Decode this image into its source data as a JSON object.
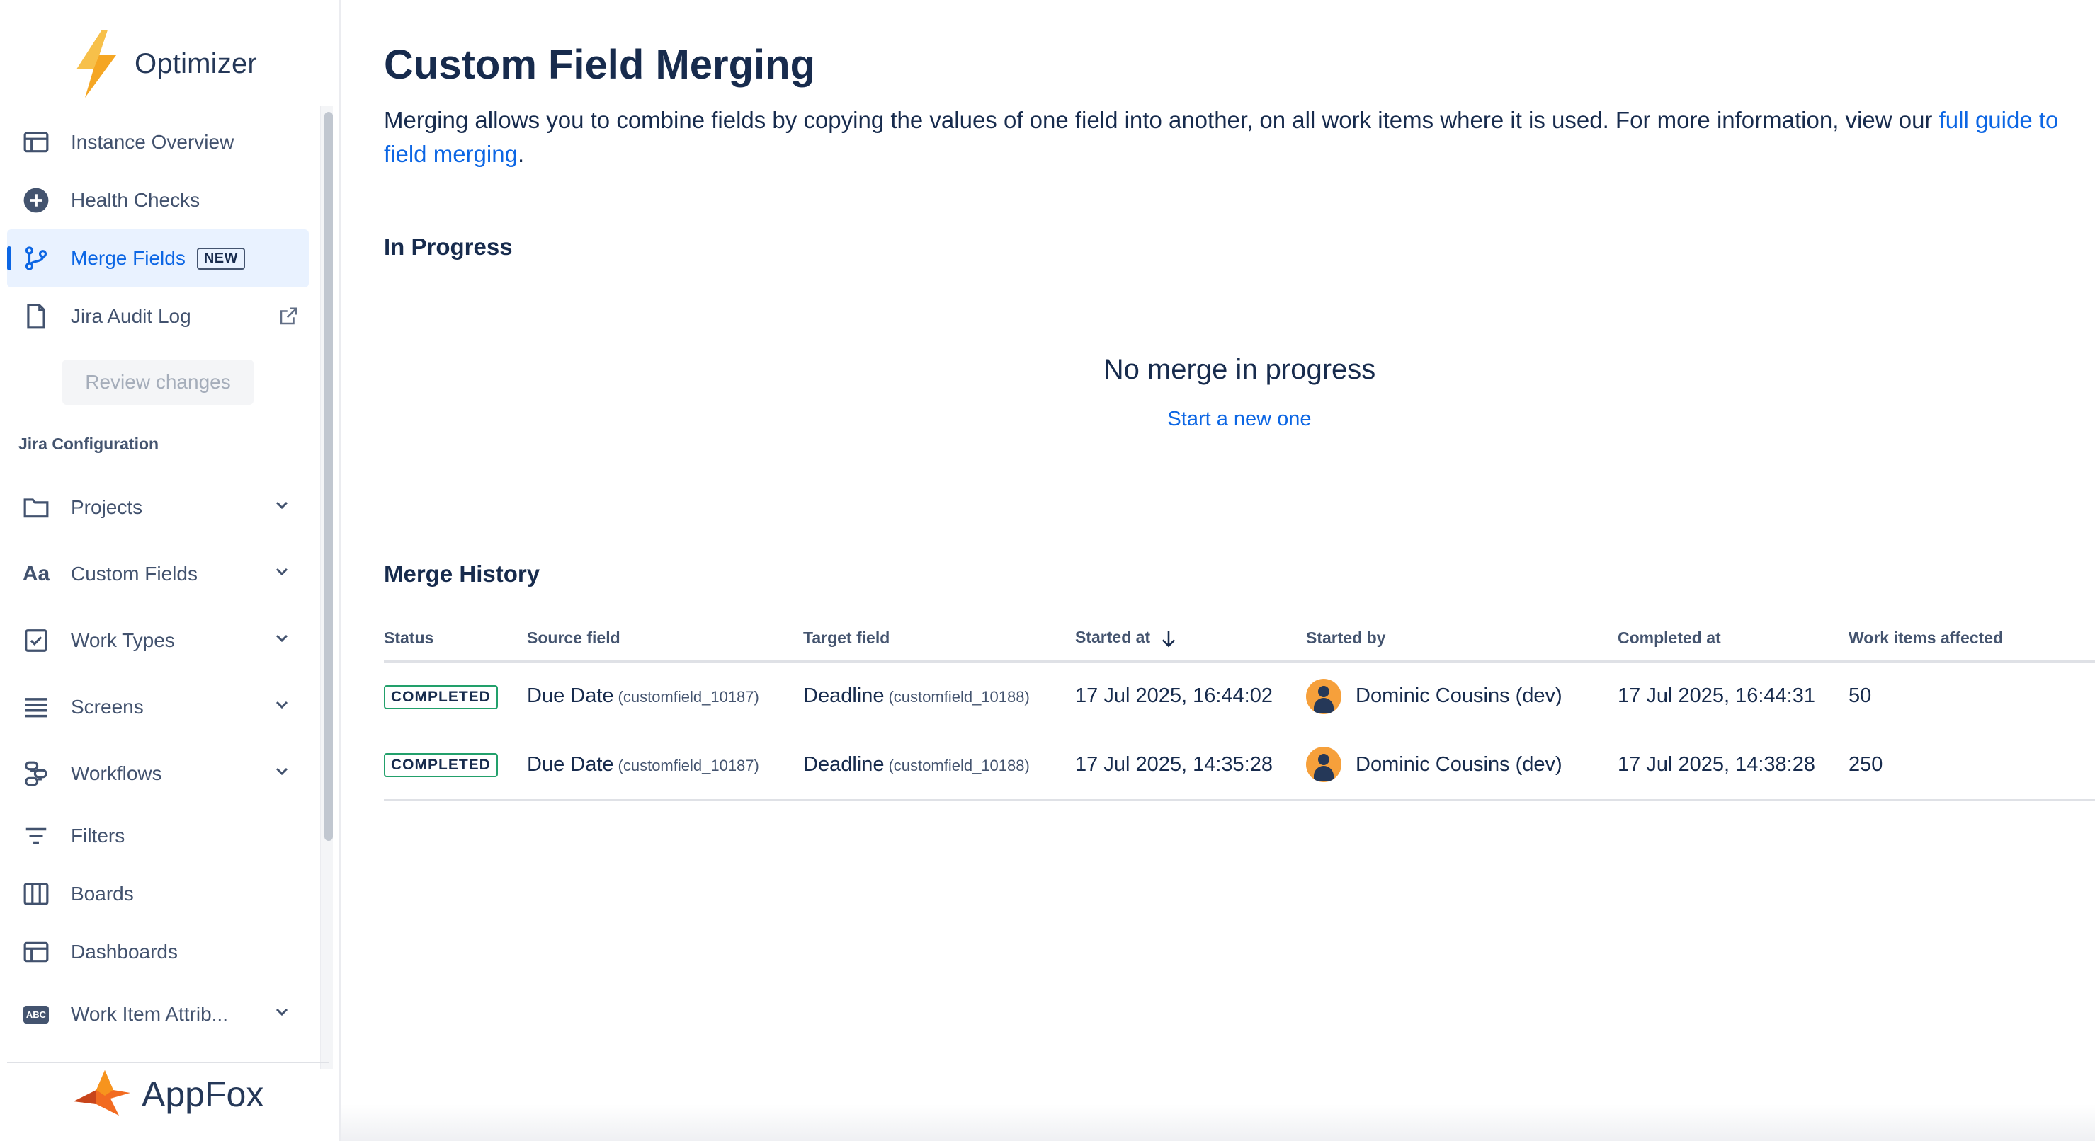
{
  "sidebar": {
    "brand": "Optimizer",
    "items": [
      {
        "label": "Instance Overview",
        "icon": "layout-icon"
      },
      {
        "label": "Health Checks",
        "icon": "plus-circle-icon"
      },
      {
        "label": "Merge Fields",
        "icon": "merge-icon",
        "badge": "NEW",
        "active": true
      },
      {
        "label": "Jira Audit Log",
        "icon": "file-icon",
        "external": true
      }
    ],
    "review_button": "Review changes",
    "section_title": "Jira Configuration",
    "config_items": [
      {
        "label": "Projects",
        "icon": "folder-icon",
        "expandable": true
      },
      {
        "label": "Custom Fields",
        "icon": "text-icon",
        "icon_text": "Aa",
        "expandable": true
      },
      {
        "label": "Work Types",
        "icon": "checkbox-icon",
        "expandable": true
      },
      {
        "label": "Screens",
        "icon": "list-icon",
        "expandable": true
      },
      {
        "label": "Workflows",
        "icon": "workflow-icon",
        "expandable": true
      },
      {
        "label": "Filters",
        "icon": "filter-icon",
        "expandable": false
      },
      {
        "label": "Boards",
        "icon": "board-icon",
        "expandable": false
      },
      {
        "label": "Dashboards",
        "icon": "dashboard-icon",
        "expandable": false
      },
      {
        "label": "Work Item Attrib...",
        "icon": "abc-icon",
        "icon_text": "ABC",
        "expandable": true
      }
    ],
    "footer_brand": "AppFox"
  },
  "main": {
    "title": "Custom Field Merging",
    "intro_text": "Merging allows you to combine fields by copying the values of one field into another, on all work items where it is used. For more information, view our ",
    "intro_link": "full guide to field merging",
    "intro_end": ".",
    "in_progress": {
      "heading": "In Progress",
      "empty_title": "No merge in progress",
      "empty_link": "Start a new one"
    },
    "history": {
      "heading": "Merge History",
      "columns": [
        "Status",
        "Source field",
        "Target field",
        "Started at",
        "Started by",
        "Completed at",
        "Work items affected"
      ],
      "rows": [
        {
          "status": "COMPLETED",
          "source": "Due Date",
          "source_id": "(customfield_10187)",
          "target": "Deadline",
          "target_id": "(customfield_10188)",
          "started_at": "17 Jul 2025, 16:44:02",
          "started_by": "Dominic Cousins (dev)",
          "completed_at": "17 Jul 2025, 16:44:31",
          "affected": "50"
        },
        {
          "status": "COMPLETED",
          "source": "Due Date",
          "source_id": "(customfield_10187)",
          "target": "Deadline",
          "target_id": "(customfield_10188)",
          "started_at": "17 Jul 2025, 14:35:28",
          "started_by": "Dominic Cousins (dev)",
          "completed_at": "17 Jul 2025, 14:38:28",
          "affected": "250"
        }
      ]
    }
  },
  "colors": {
    "accent": "#0c66e4",
    "text": "#172b4d",
    "subtle": "#44546f",
    "success_border": "#22a06b",
    "avatar": "#f6a03b"
  }
}
